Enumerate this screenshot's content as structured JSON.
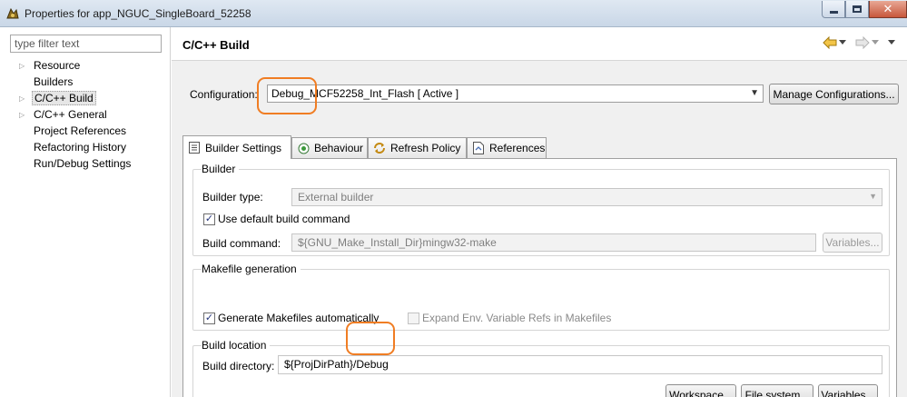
{
  "window": {
    "title": "Properties for app_NGUC_SingleBoard_52258"
  },
  "sidebar": {
    "filter_placeholder": "type filter text",
    "items": [
      {
        "label": "Resource",
        "expandable": true
      },
      {
        "label": "Builders",
        "expandable": false
      },
      {
        "label": "C/C++ Build",
        "expandable": true,
        "selected": true
      },
      {
        "label": "C/C++ General",
        "expandable": true
      },
      {
        "label": "Project References",
        "expandable": false
      },
      {
        "label": "Refactoring History",
        "expandable": false
      },
      {
        "label": "Run/Debug Settings",
        "expandable": false
      }
    ]
  },
  "header": {
    "title": "C/C++ Build"
  },
  "configuration": {
    "label": "Configuration:",
    "value": "Debug_MCF52258_Int_Flash  [ Active ]",
    "manage_button": "Manage Configurations..."
  },
  "tabs": [
    {
      "label": "Builder Settings",
      "icon": "list-icon",
      "active": true
    },
    {
      "label": "Behaviour",
      "icon": "radio-icon",
      "active": false
    },
    {
      "label": "Refresh Policy",
      "icon": "refresh-icon",
      "active": false
    },
    {
      "label": "References",
      "icon": "references-icon",
      "active": false
    }
  ],
  "builder": {
    "group_title": "Builder",
    "type_label": "Builder type:",
    "type_value": "External builder",
    "use_default_label": "Use default build command",
    "use_default_checked": true,
    "command_label": "Build command:",
    "command_value": "${GNU_Make_Install_Dir}mingw32-make",
    "variables_button": "Variables..."
  },
  "makefile": {
    "group_title": "Makefile generation",
    "generate_label": "Generate Makefiles automatically",
    "generate_checked": true,
    "expand_label": "Expand Env. Variable Refs in Makefiles",
    "expand_checked": false
  },
  "build_location": {
    "group_title": "Build location",
    "dir_label": "Build directory:",
    "dir_value": "${ProjDirPath}/Debug",
    "workspace_button": "Workspace...",
    "filesystem_button": "File system...",
    "variables_button": "Variables..."
  },
  "colors": {
    "highlight": "#f07d23",
    "selection_bg": "#e6e6e6"
  }
}
